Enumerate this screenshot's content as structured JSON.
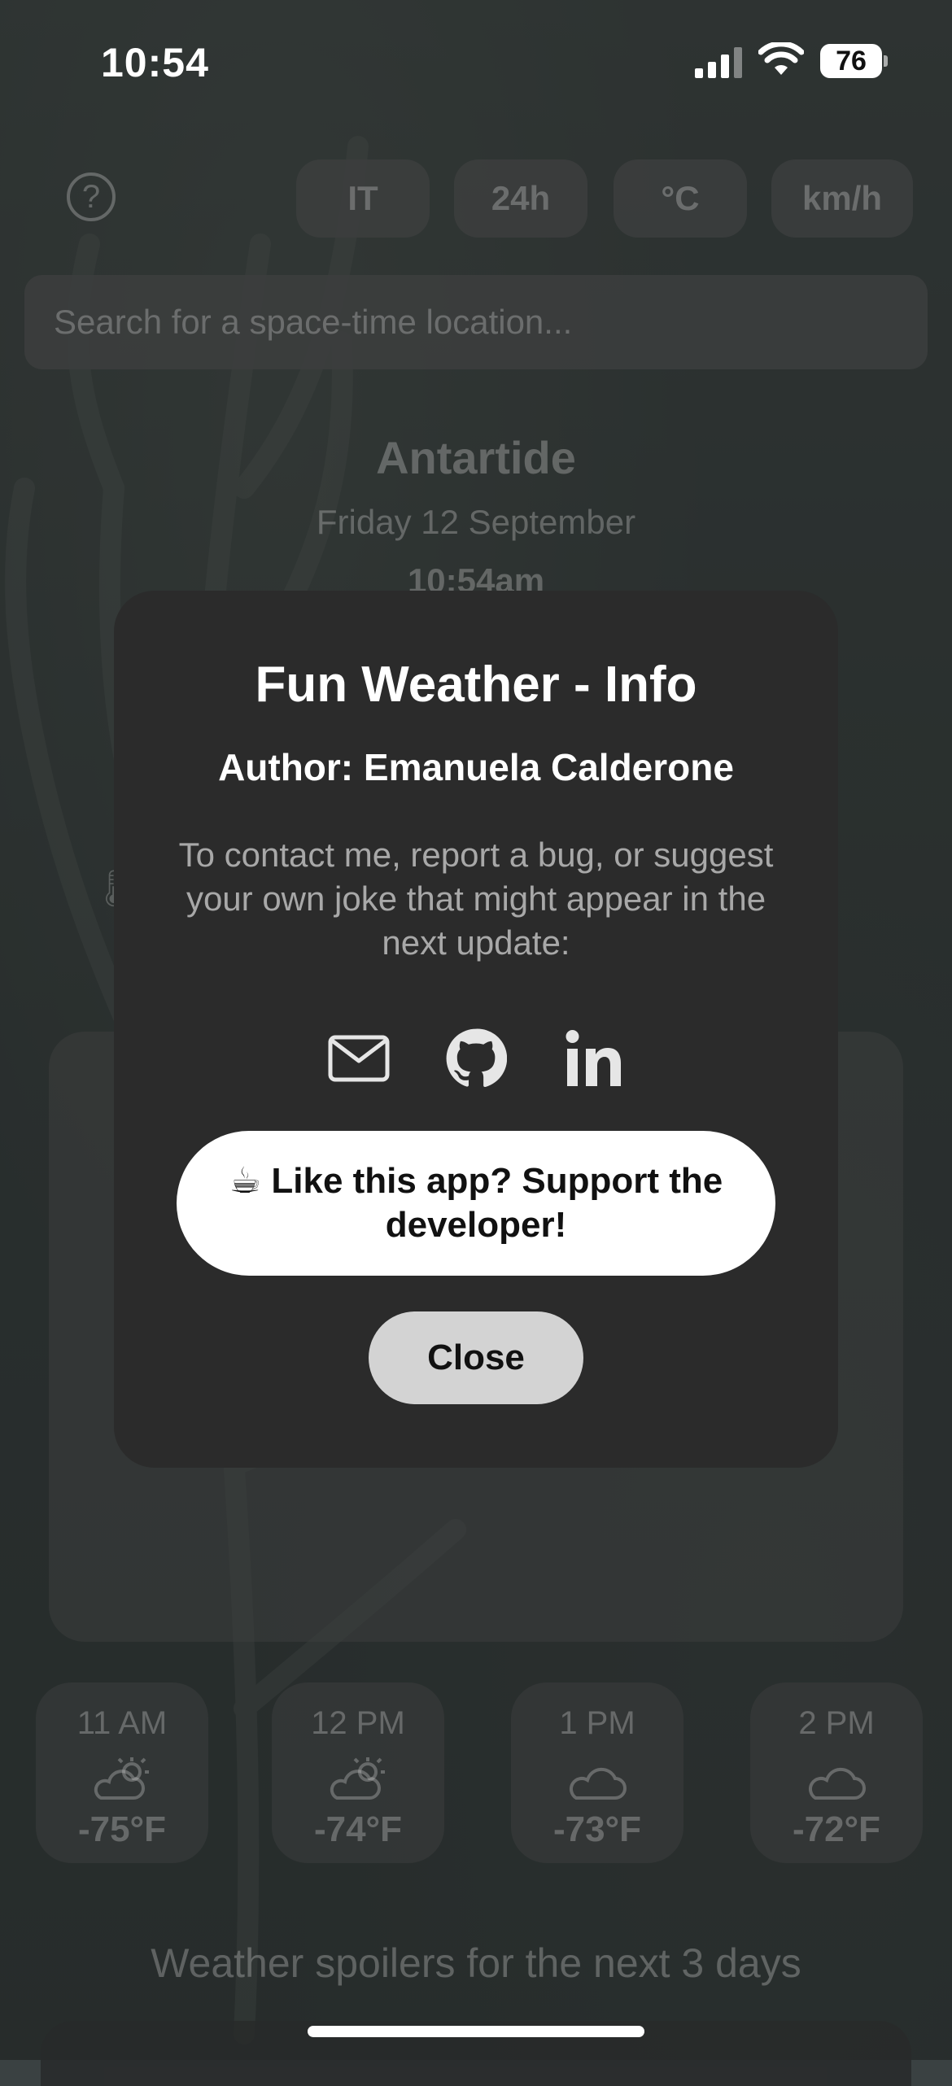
{
  "status_bar": {
    "time": "10:54",
    "battery": "76"
  },
  "toolbar": {
    "help_icon": "question-circle-icon",
    "language": "IT",
    "time_format": "24h",
    "temperature_unit": "°C",
    "speed_unit": "km/h"
  },
  "search": {
    "placeholder": "Search for a space-time location..."
  },
  "location": {
    "name": "Antartide",
    "date": "Friday 12 September",
    "time": "10:54am"
  },
  "hourly": [
    {
      "hour": "11 AM",
      "icon": "partly-sunny-icon",
      "temp": "-75°F"
    },
    {
      "hour": "12 PM",
      "icon": "partly-sunny-icon",
      "temp": "-74°F"
    },
    {
      "hour": "1 PM",
      "icon": "cloud-icon",
      "temp": "-73°F"
    },
    {
      "hour": "2 PM",
      "icon": "cloud-icon",
      "temp": "-72°F"
    }
  ],
  "spoilers_heading": "Weather spoilers for the next 3 days",
  "modal": {
    "title": "Fun Weather - Info",
    "author": "Author: Emanuela Calderone",
    "description": "To contact me, report a bug, or suggest your own joke that might appear in the next update:",
    "contacts": [
      "mail-icon",
      "github-icon",
      "linkedin-icon"
    ],
    "support_button": "☕ Like this app? Support the developer!",
    "close_button": "Close"
  }
}
